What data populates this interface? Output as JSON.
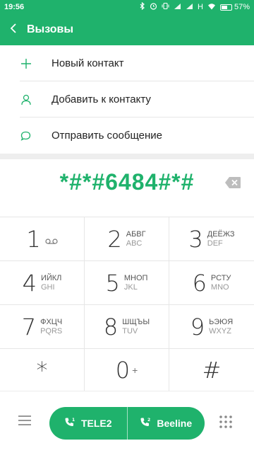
{
  "status_bar": {
    "time": "19:56",
    "network_label": "H",
    "battery_percent": "57%"
  },
  "header": {
    "title": "Вызовы",
    "back_icon": "chevron-left-icon"
  },
  "actions": [
    {
      "label": "Новый контакт",
      "icon": "plus-icon"
    },
    {
      "label": "Добавить к контакту",
      "icon": "person-icon"
    },
    {
      "label": "Отправить сообщение",
      "icon": "message-icon"
    }
  ],
  "dialer": {
    "number": "*#*#6484#*#",
    "backspace_icon": "backspace-icon"
  },
  "keypad": [
    {
      "digit": "1",
      "letters": "",
      "latin": "",
      "extra": "voicemail-icon"
    },
    {
      "digit": "2",
      "letters": "АБВГ",
      "latin": "ABC"
    },
    {
      "digit": "3",
      "letters": "ДЕЁЖЗ",
      "latin": "DEF"
    },
    {
      "digit": "4",
      "letters": "ИЙКЛ",
      "latin": "GHI"
    },
    {
      "digit": "5",
      "letters": "МНОП",
      "latin": "JKL"
    },
    {
      "digit": "6",
      "letters": "РСТУ",
      "latin": "MNO"
    },
    {
      "digit": "7",
      "letters": "ФХЦЧ",
      "latin": "PQRS"
    },
    {
      "digit": "8",
      "letters": "ШЩЪЫ",
      "latin": "TUV"
    },
    {
      "digit": "9",
      "letters": "ЬЭЮЯ",
      "latin": "WXYZ"
    },
    {
      "digit": "*",
      "letters": "",
      "latin": ""
    },
    {
      "digit": "0",
      "letters": "",
      "latin": "",
      "plus": "+"
    },
    {
      "digit": "#",
      "letters": "",
      "latin": ""
    }
  ],
  "bottom_bar": {
    "sim1_label": "TELE2",
    "sim2_label": "Beeline",
    "sim1_number": "1",
    "sim2_number": "2"
  },
  "colors": {
    "accent": "#1fb26c",
    "divider": "#e6e6e6"
  }
}
